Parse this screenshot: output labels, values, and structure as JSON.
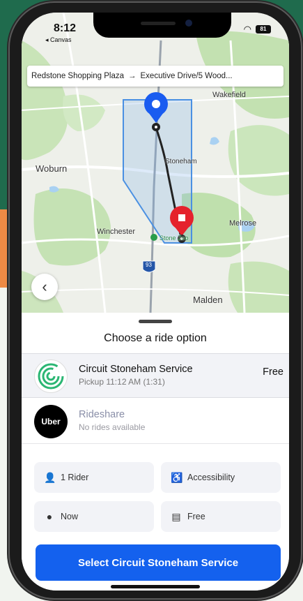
{
  "status_bar": {
    "time": "8:12",
    "carrier": "◂ Canvas",
    "battery": "81"
  },
  "route": {
    "from": "Redstone Shopping Plaza",
    "arrow": "→",
    "to": "Executive Drive/5 Wood..."
  },
  "map_labels": {
    "wakefield": "Wakefield",
    "woburn": "Woburn",
    "stoneham": "Stoneham",
    "winchester": "Winchester",
    "melrose": "Melrose",
    "zoo": "Stone Zoo",
    "malden": "Malden",
    "interstate": "93"
  },
  "sheet": {
    "title": "Choose a ride option",
    "options": [
      {
        "name": "Circuit Stoneham Service",
        "subtitle": "Pickup 11:12 AM (1:31)",
        "price": "Free"
      },
      {
        "name": "Rideshare",
        "subtitle": "No rides available",
        "logo": "Uber"
      }
    ],
    "chips": {
      "riders": "1 Rider",
      "accessibility": "Accessibility",
      "time": "Now",
      "payment": "Free"
    },
    "select_button": "Select Circuit Stoneham Service"
  },
  "colors": {
    "accent": "#1461ee",
    "pickup_pin": "#1a5cf0",
    "dropoff_pin": "#e5222c",
    "service_area": "#4a90e2",
    "circuit_green": "#2bb673"
  },
  "icons": {
    "back": "chevron-left-icon",
    "rider": "person-icon",
    "accessibility": "wheelchair-icon",
    "time": "clock-icon",
    "payment": "payment-icon"
  }
}
